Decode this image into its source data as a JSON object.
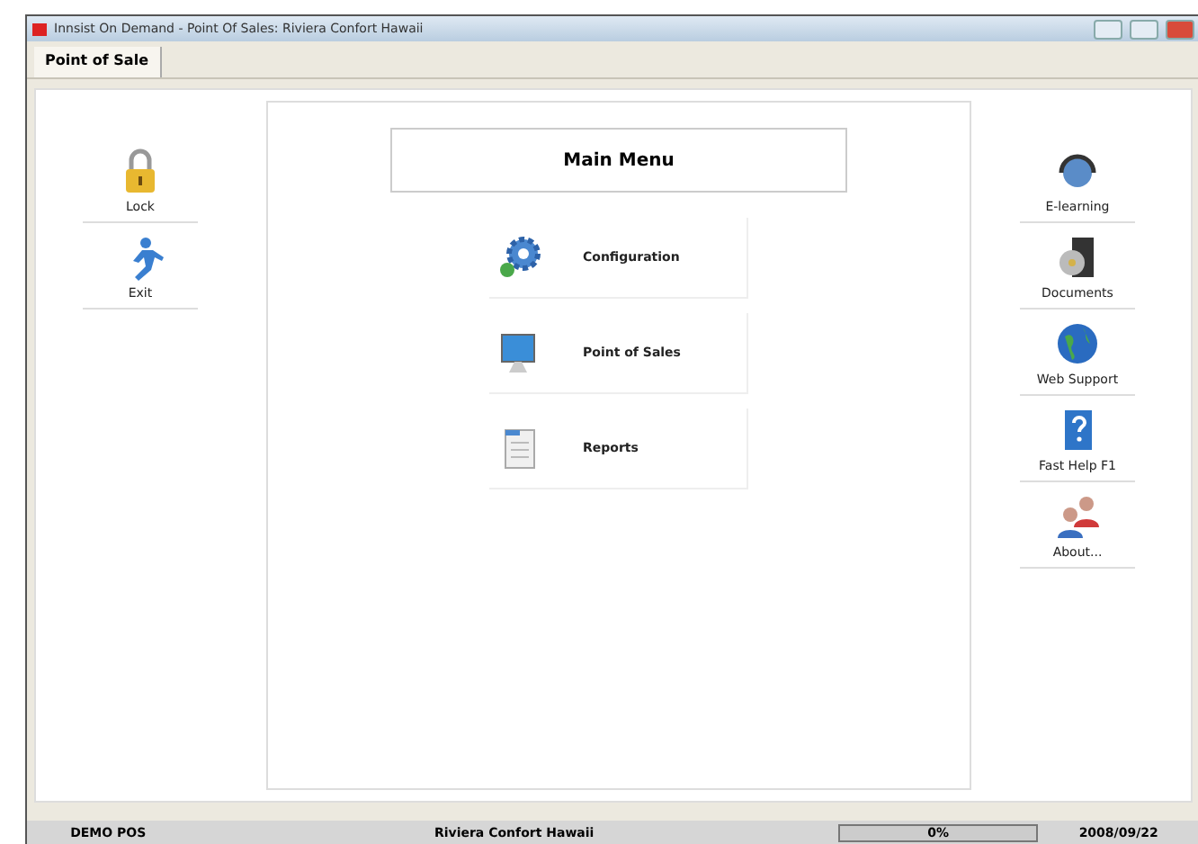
{
  "window": {
    "title": "Innsist On Demand - Point Of Sales: Riviera Confort Hawaii"
  },
  "tabs": [
    {
      "label": "Point of Sale",
      "selected": true
    }
  ],
  "left_actions": [
    {
      "label": "Lock"
    },
    {
      "label": "Exit"
    }
  ],
  "main_menu": {
    "title": "Main Menu",
    "items": [
      {
        "label": "Configuration"
      },
      {
        "label": "Point of Sales"
      },
      {
        "label": "Reports"
      }
    ]
  },
  "right_actions": [
    {
      "label": "E-learning"
    },
    {
      "label": "Documents"
    },
    {
      "label": "Web Support"
    },
    {
      "label": "Fast Help F1"
    },
    {
      "label": "About..."
    }
  ],
  "status_bar": [
    "DEMO POS",
    "Riviera Confort Hawaii",
    "0%",
    "2008/09/22"
  ]
}
